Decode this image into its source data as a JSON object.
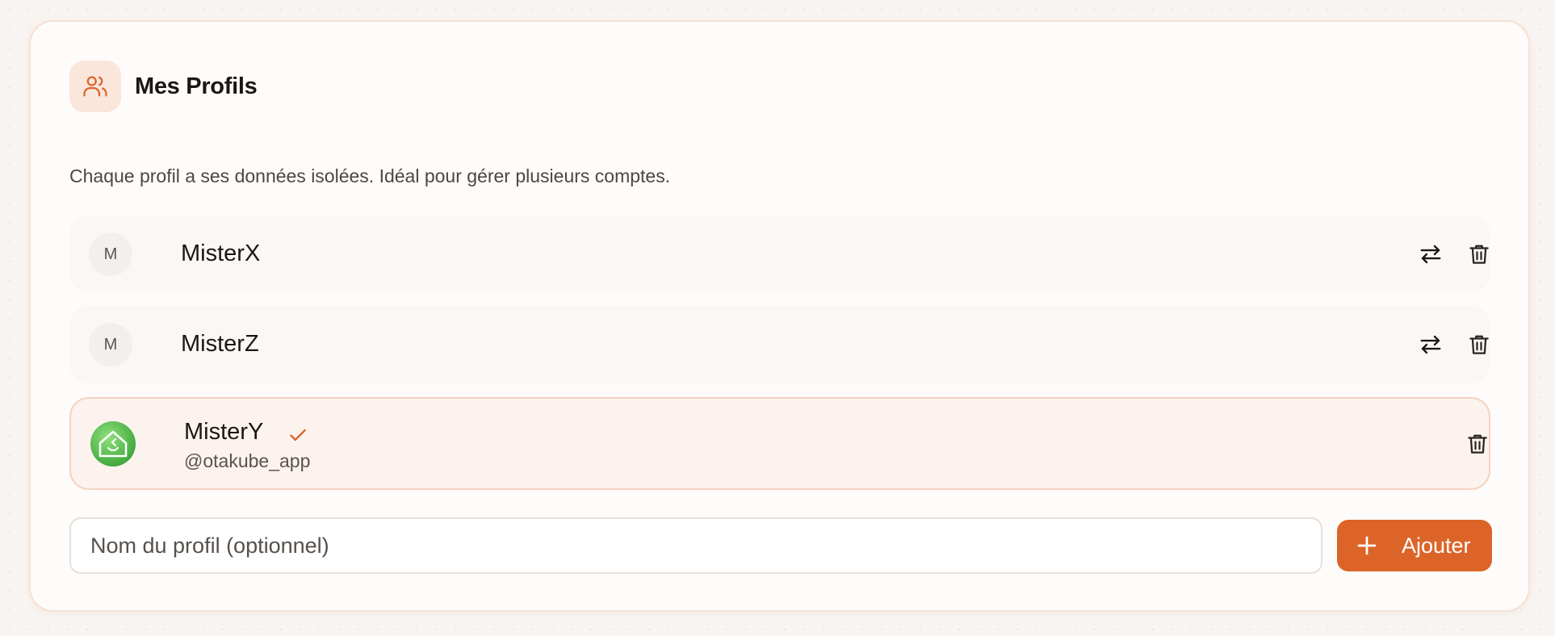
{
  "header": {
    "title": "Mes Profils",
    "icon": "users-icon",
    "accent_color": "#dc6428"
  },
  "description": "Chaque profil a ses données isolées. Idéal pour gérer plusieurs comptes.",
  "profiles": [
    {
      "name": "MisterX",
      "initial": "M",
      "active": false
    },
    {
      "name": "MisterZ",
      "initial": "M",
      "active": false
    },
    {
      "name": "MisterY",
      "handle": "@otakube_app",
      "active": true,
      "avatar": "house-app-icon"
    }
  ],
  "new_profile": {
    "value": "",
    "placeholder": "Nom du profil (optionnel)",
    "add_label": "Ajouter"
  }
}
